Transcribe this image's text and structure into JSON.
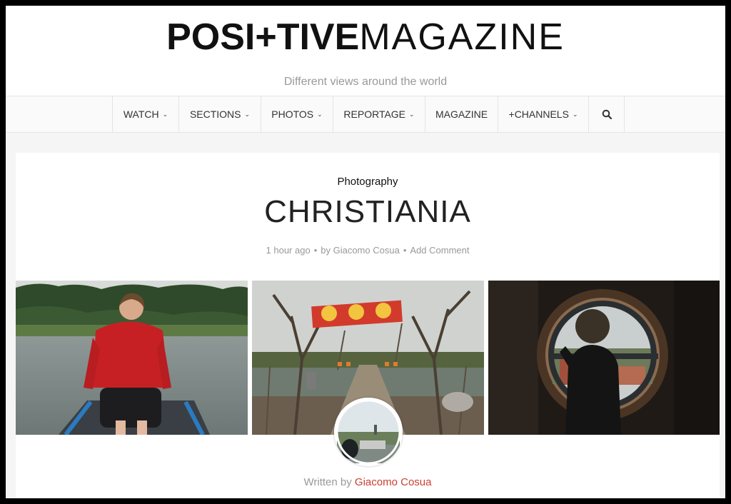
{
  "header": {
    "logo_bold": "POSI+TIVE",
    "logo_light": "MAGAZINE",
    "tagline": "Different views around the world"
  },
  "nav": {
    "items": [
      {
        "label": "WATCH",
        "dropdown": true
      },
      {
        "label": "SECTIONS",
        "dropdown": true
      },
      {
        "label": "PHOTOS",
        "dropdown": true
      },
      {
        "label": "REPORTAGE",
        "dropdown": true
      },
      {
        "label": "MAGAZINE",
        "dropdown": false
      },
      {
        "label": "+CHANNELS",
        "dropdown": true
      }
    ],
    "search_icon": "search-icon"
  },
  "article": {
    "category": "Photography",
    "title": "CHRISTIANIA",
    "time": "1 hour ago",
    "by": "by Giacomo Cosua",
    "comment": "Add Comment",
    "written_prefix": "Written by",
    "author": "Giacomo Cosua"
  },
  "colors": {
    "accent": "#c9402f",
    "muted": "#999999"
  }
}
